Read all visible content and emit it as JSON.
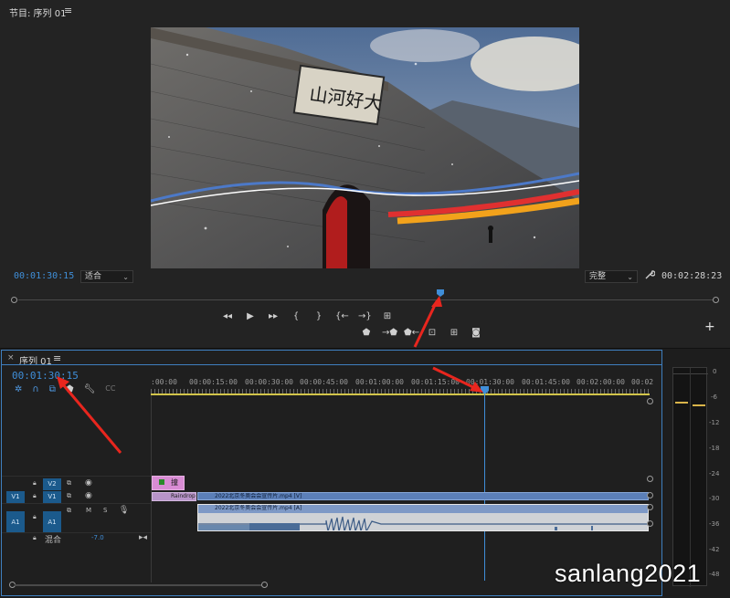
{
  "program": {
    "title": "节目: 序列 01",
    "menu_icon": "≡",
    "current_time": "00:01:30:15",
    "fit_value": "适合",
    "quality_value": "完整",
    "duration": "00:02:28:23",
    "playhead_fraction": 0.61,
    "video_sign_text": "山河好大",
    "controls": [
      "mark-in-icon",
      "play-icon",
      "mark-out-icon",
      "bracket-in-icon",
      "bracket-out-icon",
      "go-to-in-icon",
      "go-to-out-icon",
      "lift-icon"
    ],
    "controls2": [
      "marker-icon",
      "insert-icon",
      "overwrite-icon",
      "extract-icon",
      "export-frame-icon",
      "camera-icon"
    ],
    "add_icon": "+"
  },
  "timeline": {
    "title": "序列 01",
    "menu_icon": "≡",
    "close_icon": "×",
    "current_time": "00:01:30:15",
    "ruler_labels": [
      ":00:00",
      "00:00:15:00",
      "00:00:30:00",
      "00:00:45:00",
      "00:01:00:00",
      "00:01:15:00",
      "00:01:30:00",
      "00:01:45:00",
      "00:02:00:00",
      "00:02"
    ],
    "tracks": {
      "v2": "V2",
      "v1": "V1",
      "v1_source": "V1",
      "a1": "A1",
      "a1_source": "A1",
      "mute": "M",
      "solo": "S"
    },
    "mix_label": "混合",
    "mix_value": "-7.0",
    "clips": {
      "title_clip": "撞",
      "raindrop_clip": "Raindrop",
      "video_clip": "2022北京冬奥会会宣传片.mp4 [V]",
      "audio_clip": "2022北京冬奥会会宣传片.mp4 [A]"
    }
  },
  "meter": {
    "db_labels": [
      "0",
      "-6",
      "-12",
      "-18",
      "-24",
      "-30",
      "-36",
      "-42",
      "-48"
    ]
  },
  "watermark": "sanlang2021",
  "colors": {
    "accent_blue": "#3f8ed8",
    "arrow_red": "#e8261e",
    "title_clip": "#d98cd4"
  }
}
